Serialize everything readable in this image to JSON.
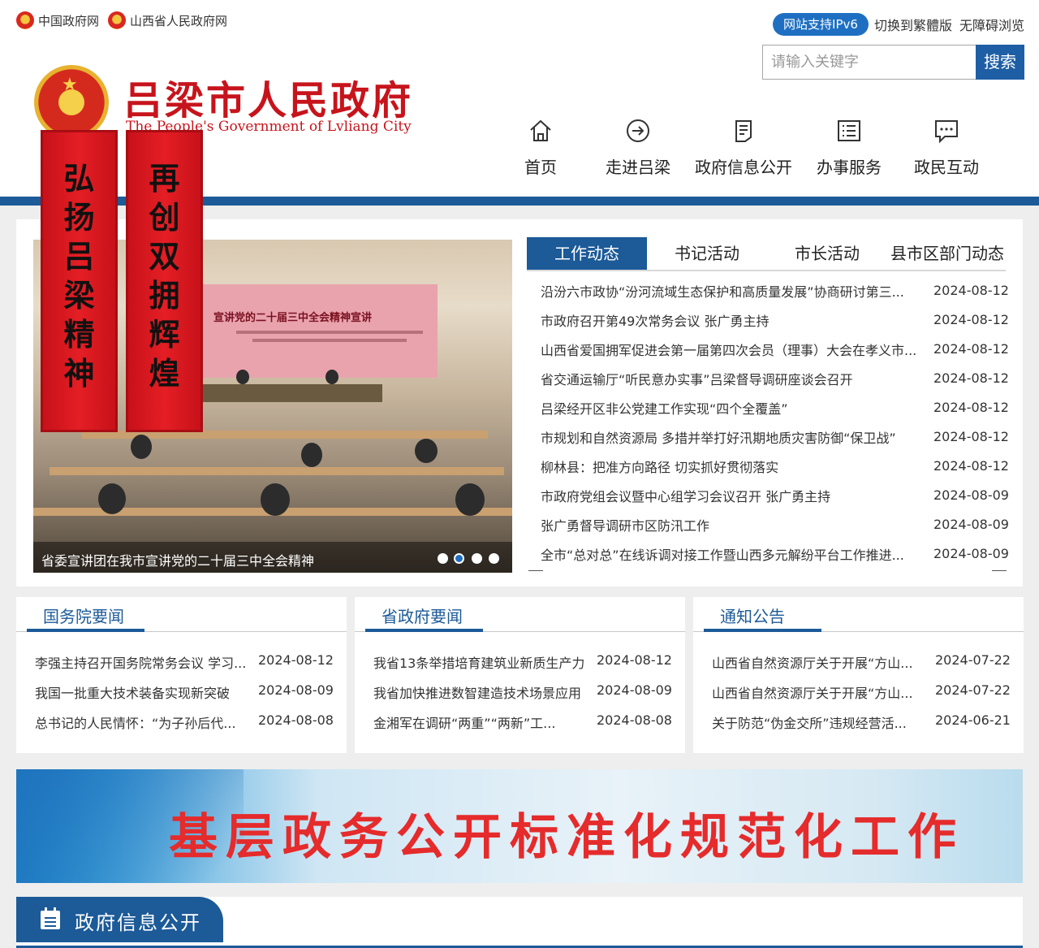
{
  "topbar": {
    "links": [
      {
        "label": "中国政府网"
      },
      {
        "label": "山西省人民政府网"
      }
    ],
    "ipv6": "网站支持IPv6",
    "traditional": "切换到繁體版",
    "accessible": "无障碍浏览"
  },
  "header": {
    "title": "吕梁市人民政府",
    "subtitle": "The People's Government of Lvliang City"
  },
  "search": {
    "placeholder": "请输入关键字",
    "button": "搜索"
  },
  "nav": [
    {
      "label": "首页",
      "icon": "home-icon"
    },
    {
      "label": "走进吕梁",
      "icon": "arrow-circle-icon"
    },
    {
      "label": "政府信息公开",
      "icon": "document-icon"
    },
    {
      "label": "办事服务",
      "icon": "list-icon"
    },
    {
      "label": "政民互动",
      "icon": "chat-icon"
    }
  ],
  "banners": {
    "left": "弘扬吕梁精神",
    "right": "再创双拥辉煌"
  },
  "slider": {
    "caption": "省委宣讲团在我市宣讲党的二十届三中全会精神",
    "stage_text": "宣讲党的二十届三中全会精神宣讲",
    "dots": 4,
    "active_dot": 2
  },
  "news_tabs": [
    {
      "label": "工作动态",
      "active": true
    },
    {
      "label": "书记活动",
      "active": false
    },
    {
      "label": "市长活动",
      "active": false
    },
    {
      "label": "县市区部门动态",
      "active": false
    }
  ],
  "news": [
    {
      "title": "沿汾六市政协“汾河流域生态保护和高质量发展”协商研讨第三...",
      "date": "2024-08-12"
    },
    {
      "title": "市政府召开第49次常务会议 张广勇主持",
      "date": "2024-08-12"
    },
    {
      "title": "山西省爱国拥军促进会第一届第四次会员（理事）大会在孝义市...",
      "date": "2024-08-12"
    },
    {
      "title": "省交通运输厅“听民意办实事”吕梁督导调研座谈会召开",
      "date": "2024-08-12"
    },
    {
      "title": "吕梁经开区非公党建工作实现“四个全覆盖”",
      "date": "2024-08-12"
    },
    {
      "title": "市规划和自然资源局 多措并举打好汛期地质灾害防御“保卫战”",
      "date": "2024-08-12"
    },
    {
      "title": "柳林县：把准方向路径 切实抓好贯彻落实",
      "date": "2024-08-12"
    },
    {
      "title": "市政府党组会议暨中心组学习会议召开 张广勇主持",
      "date": "2024-08-09"
    },
    {
      "title": "张广勇督导调研市区防汛工作",
      "date": "2024-08-09"
    },
    {
      "title": "全市“总对总”在线诉调对接工作暨山西多元解纷平台工作推进...",
      "date": "2024-08-09"
    }
  ],
  "columns": [
    {
      "title": "国务院要闻",
      "items": [
        {
          "title": "李强主持召开国务院常务会议 学习...",
          "date": "2024-08-12"
        },
        {
          "title": "我国一批重大技术装备实现新突破",
          "date": "2024-08-09"
        },
        {
          "title": "总书记的人民情怀：“为子孙后代...",
          "date": "2024-08-08"
        }
      ]
    },
    {
      "title": "省政府要闻",
      "items": [
        {
          "title": "我省13条举措培育建筑业新质生产力",
          "date": "2024-08-12"
        },
        {
          "title": "我省加快推进数智建造技术场景应用",
          "date": "2024-08-09"
        },
        {
          "title": "金湘军在调研“两重”“两新”工...",
          "date": "2024-08-08"
        }
      ]
    },
    {
      "title": "通知公告",
      "items": [
        {
          "title": "山西省自然资源厅关于开展“方山...",
          "date": "2024-07-22"
        },
        {
          "title": "山西省自然资源厅关于开展“方山...",
          "date": "2024-07-22"
        },
        {
          "title": "关于防范“伪金交所”违规经营活...",
          "date": "2024-06-21"
        }
      ]
    }
  ],
  "wide_banner": {
    "text": "基层政务公开标准化规范化工作"
  },
  "section": {
    "title": "政府信息公开",
    "icon": "calendar-list-icon"
  },
  "colors": {
    "brand_blue": "#1c5a98",
    "brand_red": "#c7141c",
    "ipv6_blue": "#1e6fc2"
  }
}
